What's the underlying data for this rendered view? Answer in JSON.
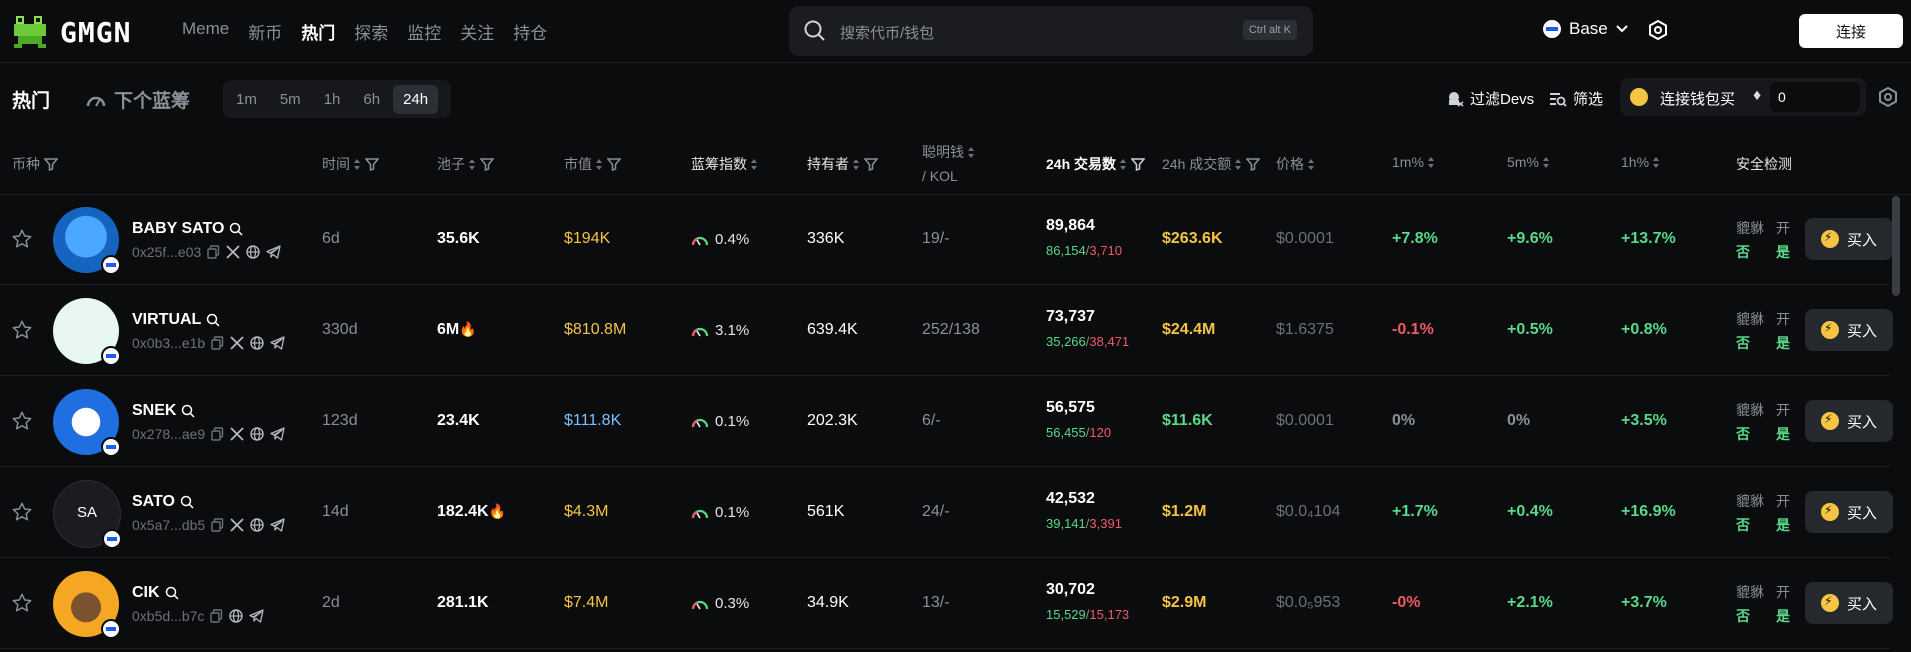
{
  "app": {
    "logo_text": "GMGN"
  },
  "nav": {
    "items": [
      "Meme",
      "新币",
      "热门",
      "探索",
      "监控",
      "关注",
      "持仓"
    ],
    "active": "热门"
  },
  "search": {
    "placeholder": "搜索代币/钱包",
    "shortcut": "Ctrl alt K"
  },
  "chain": {
    "name": "Base"
  },
  "header": {
    "connect_label": "连接"
  },
  "subbar": {
    "tab_hot": "热门",
    "tab_next": "下个蓝筹",
    "periods": [
      "1m",
      "5m",
      "1h",
      "6h",
      "24h"
    ],
    "selected_period": "24h",
    "filter_devs": "过滤Devs",
    "screen": "筛选",
    "wallet_buy": "连接钱包买",
    "amount": "0"
  },
  "columns": {
    "coin": "币种",
    "age": "时间",
    "pool": "池子",
    "mcap": "市值",
    "bluechip": "蓝筹指数",
    "holders": "持有者",
    "smart": "聪明钱",
    "kol": "/ KOL",
    "txs": "24h 交易数",
    "volume": "24h 成交额",
    "price": "价格",
    "p1m": "1m%",
    "p5m": "5m%",
    "p1h": "1h%",
    "security": "安全检测"
  },
  "rows": [
    {
      "name": "BABY SATO",
      "addr": "0x25f...e03",
      "age": "6d",
      "pool": "35.6K",
      "pool_fire": "",
      "mcap": "$194K",
      "mcap_color": "gold",
      "bluechip": "0.4%",
      "holders": "336K",
      "smart": "19/-",
      "txs": "89,864",
      "buys": "86,154",
      "sells": "3,710",
      "volume": "$263.6K",
      "volume_color": "gold",
      "price": "$0.0001",
      "p1m": "+7.8%",
      "p1m_c": "green",
      "p5m": "+9.6%",
      "p5m_c": "green",
      "p1h": "+13.7%",
      "p1h_c": "green",
      "sec_a": "貔貅",
      "sec_b": "否",
      "sec_c": "开",
      "sec_d": "是",
      "buy": "买入",
      "socials": [
        "copy",
        "x",
        "web",
        "tg"
      ]
    },
    {
      "name": "VIRTUAL",
      "addr": "0x0b3...e1b",
      "age": "330d",
      "pool": "6M",
      "pool_fire": "🔥",
      "mcap": "$810.8M",
      "mcap_color": "gold",
      "bluechip": "3.1%",
      "holders": "639.4K",
      "smart": "252/138",
      "txs": "73,737",
      "buys": "35,266",
      "sells": "38,471",
      "volume": "$24.4M",
      "volume_color": "gold",
      "price": "$1.6375",
      "p1m": "-0.1%",
      "p1m_c": "red",
      "p5m": "+0.5%",
      "p5m_c": "green",
      "p1h": "+0.8%",
      "p1h_c": "green",
      "sec_a": "貔貅",
      "sec_b": "否",
      "sec_c": "开",
      "sec_d": "是",
      "buy": "买入",
      "socials": [
        "copy",
        "x",
        "web",
        "tg"
      ]
    },
    {
      "name": "SNEK",
      "addr": "0x278...ae9",
      "age": "123d",
      "pool": "23.4K",
      "pool_fire": "",
      "mcap": "$111.8K",
      "mcap_color": "lblue",
      "bluechip": "0.1%",
      "holders": "202.3K",
      "smart": "6/-",
      "txs": "56,575",
      "buys": "56,455",
      "sells": "120",
      "volume": "$11.6K",
      "volume_color": "green",
      "price": "$0.0001",
      "p1m": "0%",
      "p1m_c": "grey",
      "p5m": "0%",
      "p5m_c": "grey",
      "p1h": "+3.5%",
      "p1h_c": "green",
      "sec_a": "貔貅",
      "sec_b": "否",
      "sec_c": "开",
      "sec_d": "是",
      "buy": "买入",
      "socials": [
        "copy",
        "x",
        "web",
        "tg"
      ]
    },
    {
      "name": "SATO",
      "addr": "0x5a7...db5",
      "age": "14d",
      "pool": "182.4K",
      "pool_fire": "🔥",
      "mcap": "$4.3M",
      "mcap_color": "gold",
      "bluechip": "0.1%",
      "holders": "561K",
      "smart": "24/-",
      "txs": "42,532",
      "buys": "39,141",
      "sells": "3,391",
      "volume": "$1.2M",
      "volume_color": "gold",
      "price": "$0.0₄104",
      "p1m": "+1.7%",
      "p1m_c": "green",
      "p5m": "+0.4%",
      "p5m_c": "green",
      "p1h": "+16.9%",
      "p1h_c": "green",
      "sec_a": "貔貅",
      "sec_b": "否",
      "sec_c": "开",
      "sec_d": "是",
      "buy": "买入",
      "avatar_text": "SA",
      "socials": [
        "copy",
        "x",
        "web",
        "tg"
      ]
    },
    {
      "name": "CIK",
      "addr": "0xb5d...b7c",
      "age": "2d",
      "pool": "281.1K",
      "pool_fire": "",
      "mcap": "$7.4M",
      "mcap_color": "gold",
      "bluechip": "0.3%",
      "holders": "34.9K",
      "smart": "13/-",
      "txs": "30,702",
      "buys": "15,529",
      "sells": "15,173",
      "volume": "$2.9M",
      "volume_color": "gold",
      "price": "$0.0₅953",
      "p1m": "-0%",
      "p1m_c": "red",
      "p5m": "+2.1%",
      "p5m_c": "green",
      "p1h": "+3.7%",
      "p1h_c": "green",
      "sec_a": "貔貅",
      "sec_b": "否",
      "sec_c": "开",
      "sec_d": "是",
      "buy": "买入",
      "socials": [
        "copy",
        "web",
        "tg"
      ]
    }
  ]
}
